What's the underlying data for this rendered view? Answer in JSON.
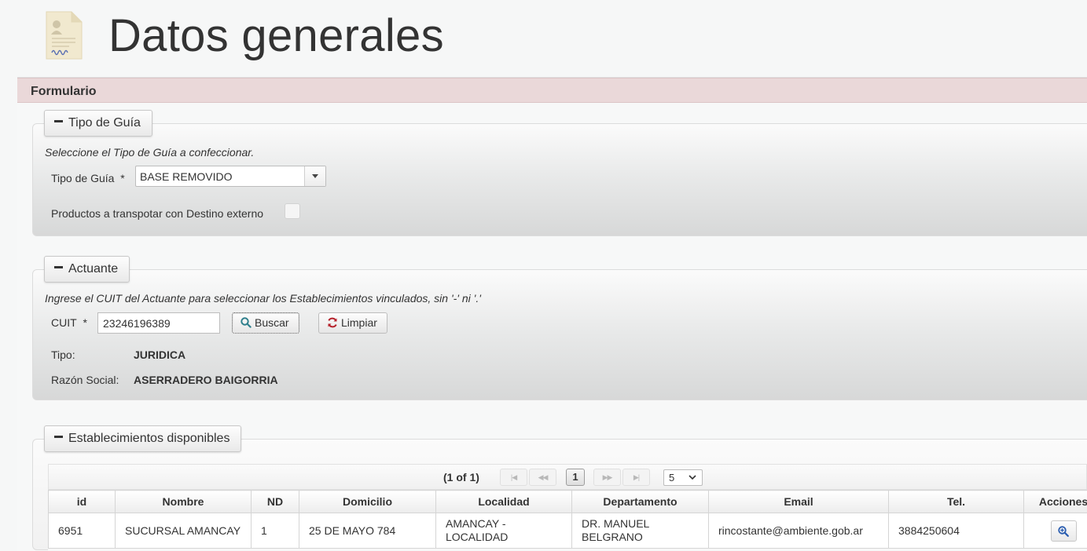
{
  "page": {
    "title": "Datos generales"
  },
  "panel": {
    "header": "Formulario"
  },
  "tipo_guia": {
    "legend": "Tipo de Guía",
    "hint": "Seleccione el Tipo de Guía a confeccionar.",
    "field_label": "Tipo de Guía",
    "required_mark": "*",
    "selected_value": "BASE REMOVIDO",
    "checkbox_label": "Productos a transpotar con Destino externo",
    "checkbox_checked": false
  },
  "actuante": {
    "legend": "Actuante",
    "hint": "Ingrese el CUIT del Actuante para seleccionar los Establecimientos vinculados, sin '-' ni '.'",
    "cuit_label": "CUIT",
    "required_mark": "*",
    "cuit_value": "23246196389",
    "search_button": "Buscar",
    "clear_button": "Limpiar",
    "tipo_label": "Tipo:",
    "tipo_value": "JURIDICA",
    "razon_label": "Razón Social:",
    "razon_value": "ASERRADERO BAIGORRIA"
  },
  "establecimientos": {
    "legend": "Establecimientos disponibles",
    "paginator": {
      "count_text": "(1 of 1)",
      "current_page": "1",
      "rows_per_page": "5"
    },
    "columns": [
      "id",
      "Nombre",
      "ND",
      "Domicilio",
      "Localidad",
      "Departamento",
      "Email",
      "Tel.",
      "Acciones"
    ],
    "rows": [
      {
        "id": "6951",
        "nombre": "SUCURSAL AMANCAY",
        "nd": "1",
        "domicilio": "25 DE MAYO 784",
        "localidad": "AMANCAY - LOCALIDAD",
        "departamento": "DR. MANUEL BELGRANO",
        "email": "rincostante@ambiente.gob.ar",
        "tel": "3884250604"
      }
    ]
  },
  "colors": {
    "panel_header_bg": "#ead8d9",
    "action_icon": "#2a5db0",
    "refresh_icon": "#b5202a",
    "search_icon": "#2f7f8c"
  },
  "icons": {
    "title": "document-icon",
    "collapse": "minus-icon",
    "search": "search-icon",
    "clear": "refresh-icon",
    "action": "zoom-in-icon",
    "dropdown": "chevron-down-icon"
  }
}
